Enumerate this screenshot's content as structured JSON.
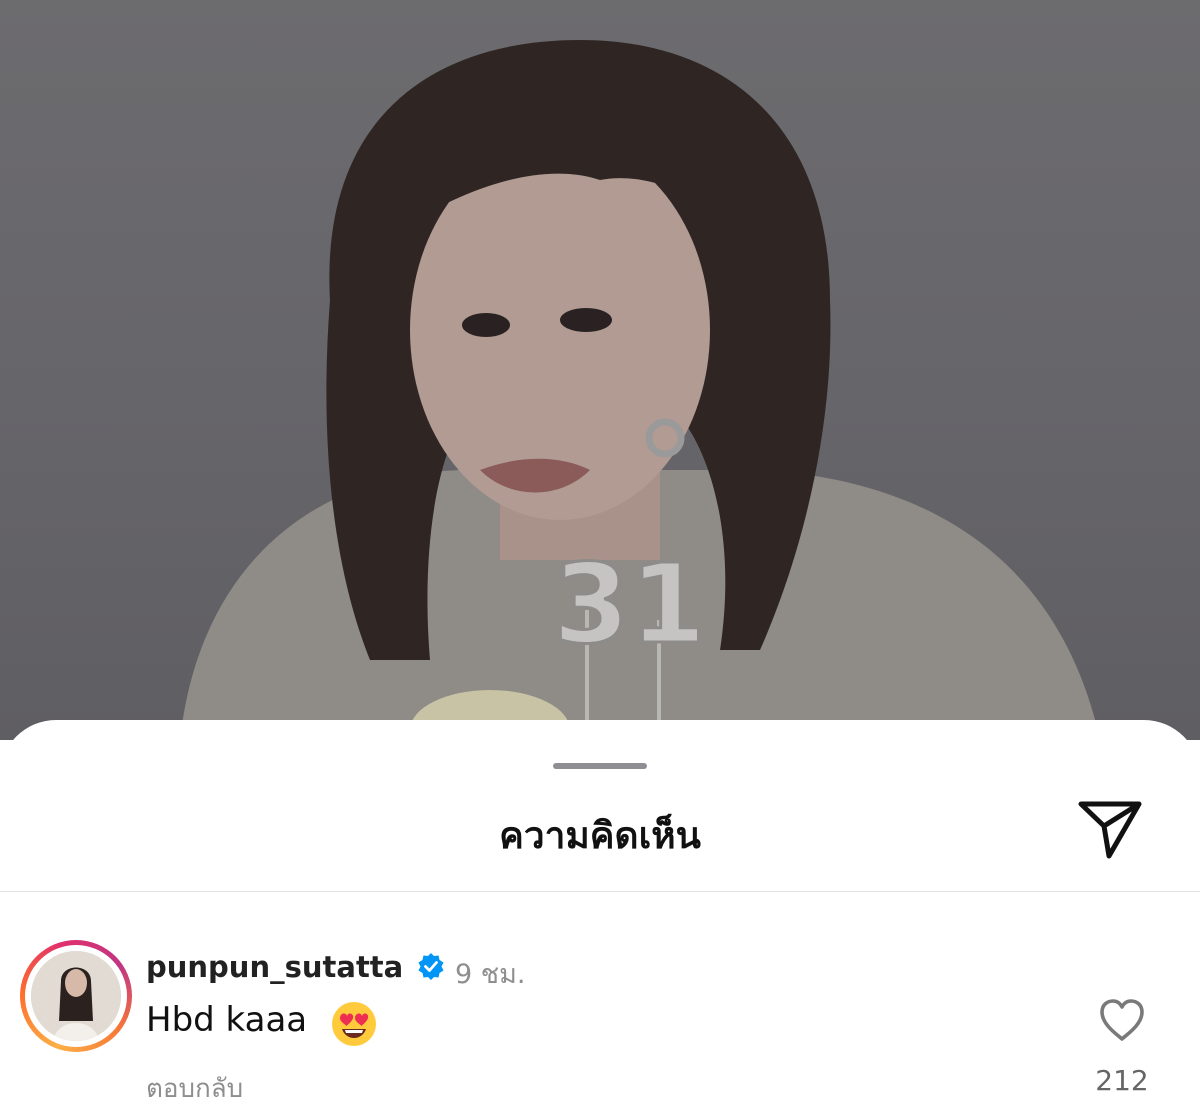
{
  "photo": {
    "candle_number": "31"
  },
  "sheet": {
    "title": "ความคิดเห็น",
    "send_icon": "paper-plane-icon"
  },
  "comment": {
    "username": "punpun_sutatta",
    "verified": true,
    "time": "9 ชม.",
    "text": "Hbd kaaa",
    "emoji": "😍",
    "reply_label": "ตอบกลับ",
    "like_icon": "heart-outline-icon",
    "like_count": "212"
  },
  "colors": {
    "verified_blue": "#0095f6",
    "secondary_text": "#8e8e8e",
    "story_ring": [
      "#fcb045",
      "#fd6e2e",
      "#e1306c",
      "#c13584"
    ]
  }
}
